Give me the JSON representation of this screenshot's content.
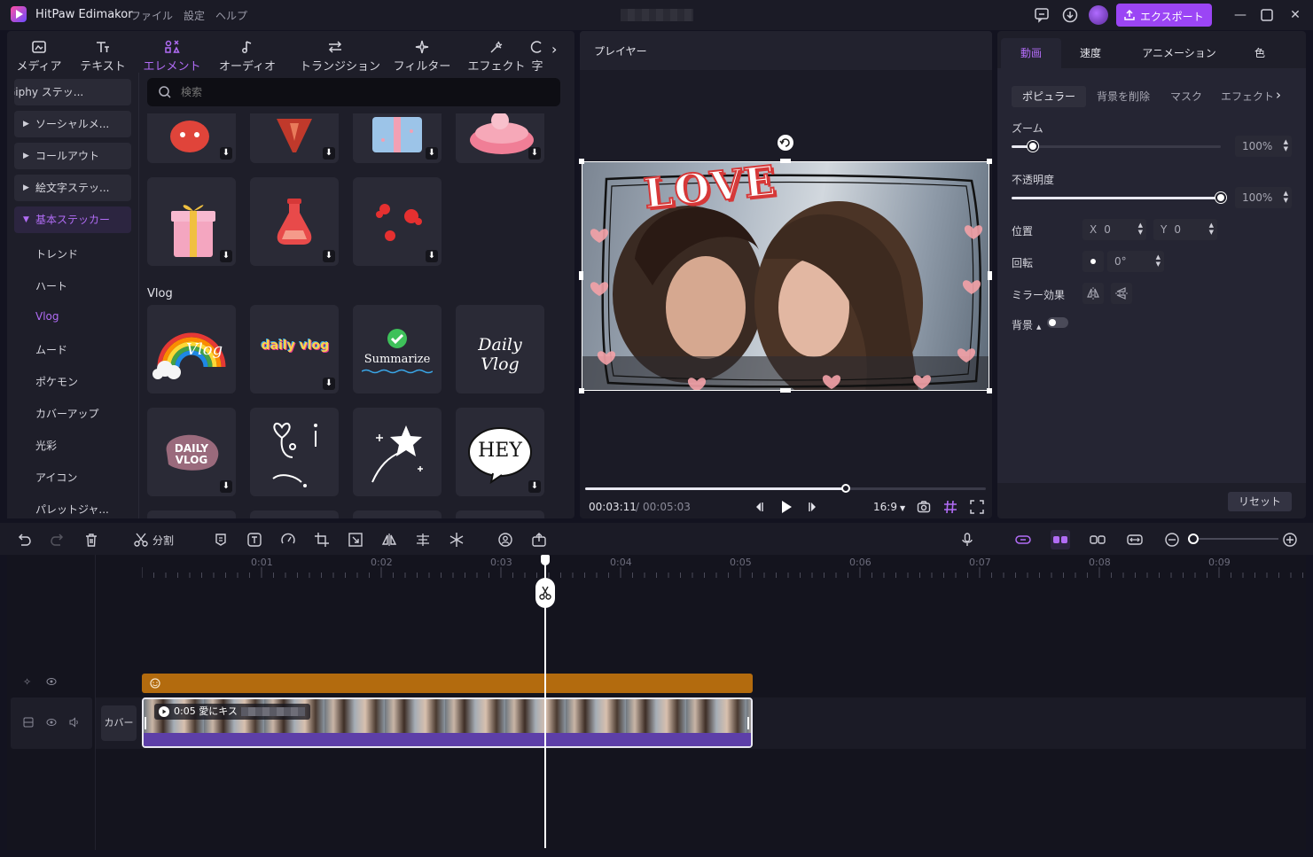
{
  "app": {
    "title": "HitPaw Edimakor",
    "menu": [
      "ファイル",
      "設定",
      "ヘルプ"
    ],
    "export_label": "エクスポート",
    "accent": "#9b45f5"
  },
  "media_tabs": [
    {
      "label": "メディア"
    },
    {
      "label": "テキスト"
    },
    {
      "label": "エレメント"
    },
    {
      "label": "オーディオ"
    },
    {
      "label": "トランジション"
    },
    {
      "label": "フィルター"
    },
    {
      "label": "エフェクト"
    },
    {
      "label": "字"
    }
  ],
  "sidebar": {
    "items": [
      "Giphy ステッ...",
      "ソーシャルメ...",
      "コールアウト",
      "絵文字ステッ...",
      "基本ステッカー"
    ],
    "sub_items": [
      "トレンド",
      "ハート",
      "Vlog",
      "ムード",
      "ポケモン",
      "カバーアップ",
      "光彩",
      "アイコン",
      "パレットジャ..."
    ]
  },
  "search": {
    "placeholder": "検索"
  },
  "sticker_section": {
    "title": "Vlog"
  },
  "sticker_texts": {
    "daily_vlog": "daily vlog",
    "summarize": "Summarize",
    "daily_vlog_script": "Daily Vlog",
    "daily_vlog_caps": "DAILY VLOG",
    "hey": "HEY",
    "vlog": "Vlog"
  },
  "player": {
    "title": "プレイヤー",
    "overlay_text": "LOVE",
    "current_time": "00:03:11",
    "separator": "/",
    "total_time": "00:05:03",
    "aspect": "16:9",
    "progress": 0.65
  },
  "props": {
    "tabs": [
      "動画",
      "速度",
      "アニメーション",
      "色"
    ],
    "subtabs": [
      "ポピュラー",
      "背景を削除",
      "マスク",
      "エフェクト"
    ],
    "zoom_label": "ズーム",
    "zoom_value": "100%",
    "zoom_level": 0.1,
    "opacity_label": "不透明度",
    "opacity_value": "100%",
    "opacity_level": 1.0,
    "position_label": "位置",
    "x_label": "X",
    "x_value": "0",
    "y_label": "Y",
    "y_value": "0",
    "rotation_label": "回転",
    "rotation_value": "0°",
    "mirror_label": "ミラー効果",
    "background_label": "背景",
    "reset_label": "リセット"
  },
  "timeline": {
    "split_label": "分割",
    "ticks": [
      "0:01",
      "0:02",
      "0:03",
      "0:04",
      "0:05",
      "0:06",
      "0:07",
      "0:08",
      "0:09"
    ],
    "cover_label": "カバー",
    "clip_label": "0:05 愛にキス"
  }
}
